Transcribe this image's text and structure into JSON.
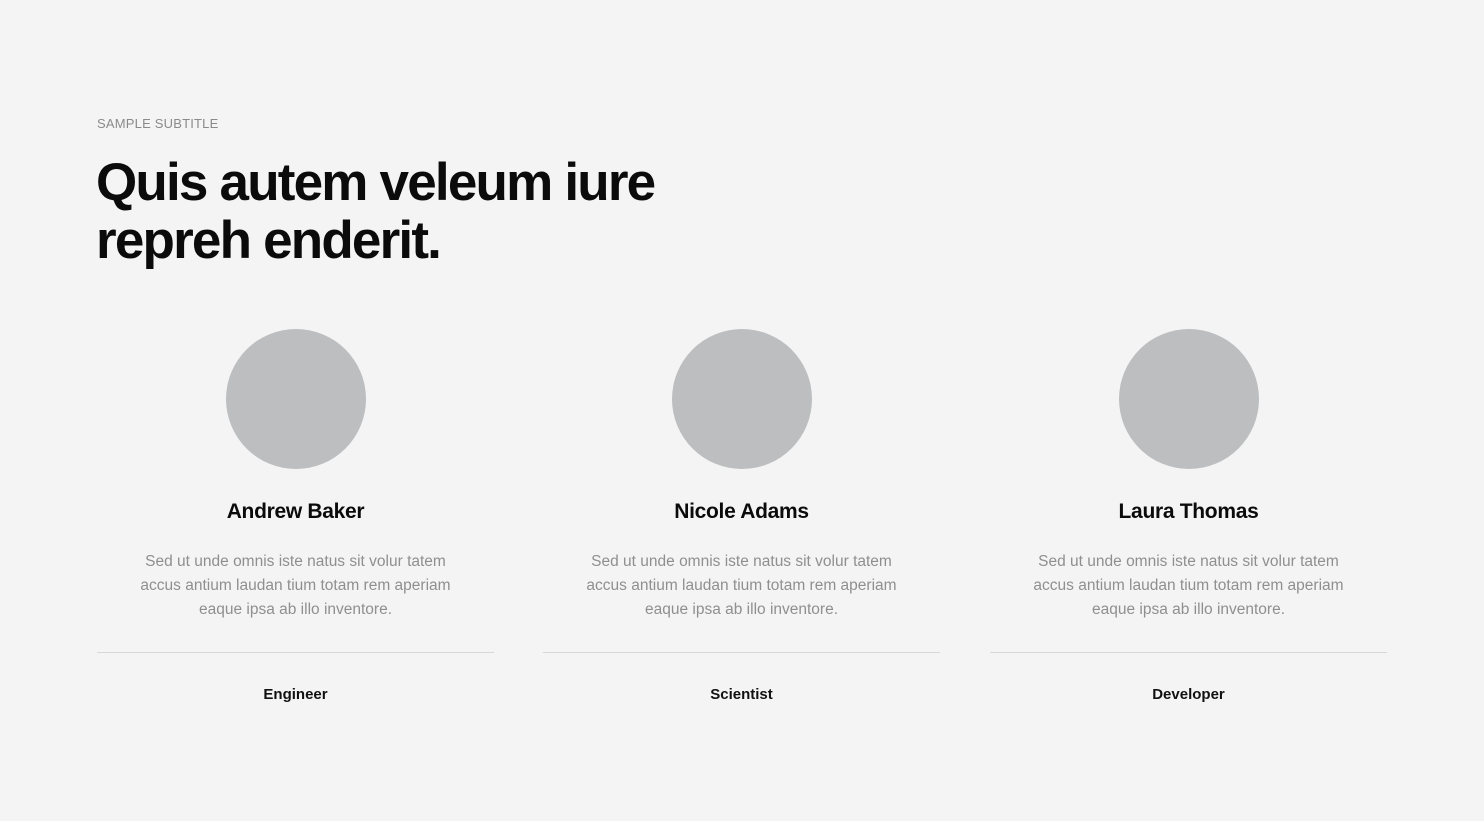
{
  "section": {
    "subtitle": "SAMPLE SUBTITLE",
    "heading": "Quis autem veleum iure repreh enderit."
  },
  "team": [
    {
      "name": "Andrew Baker",
      "bio": "Sed ut unde omnis iste natus sit volur tatem accus antium laudan tium totam rem aperiam eaque ipsa ab illo inventore.",
      "role": "Engineer"
    },
    {
      "name": "Nicole Adams",
      "bio": "Sed ut unde omnis iste natus sit volur tatem accus antium laudan tium totam rem aperiam eaque ipsa ab illo inventore.",
      "role": "Scientist"
    },
    {
      "name": "Laura Thomas",
      "bio": "Sed ut unde omnis iste natus sit volur tatem accus antium laudan tium totam rem aperiam eaque ipsa ab illo inventore.",
      "role": "Developer"
    }
  ],
  "colors": {
    "background": "#f4f4f4",
    "heading": "#0b0b0b",
    "muted_text": "#8f8f8f",
    "avatar_placeholder": "#bdbebf",
    "divider": "#d8d8d8"
  }
}
